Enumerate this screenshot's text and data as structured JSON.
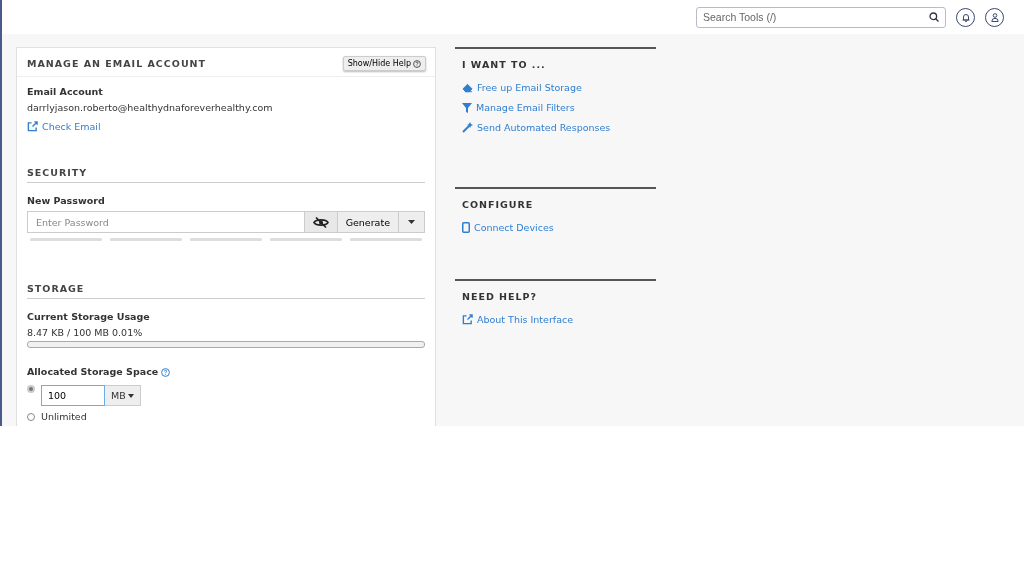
{
  "header": {
    "search": {
      "placeholder": "Search Tools (/)"
    }
  },
  "card": {
    "title": "MANAGE AN EMAIL ACCOUNT",
    "help_button": "Show/Hide Help",
    "email_account": {
      "label": "Email Account",
      "value": "darrlyjason.roberto@healthydnaforeverhealthy.com",
      "link": "Check Email"
    },
    "security": {
      "heading": "SECURITY",
      "label": "New Password",
      "placeholder": "Enter Password",
      "generate": "Generate"
    },
    "storage": {
      "heading": "STORAGE",
      "usage_label": "Current Storage Usage",
      "usage": "8.47 KB / 100 MB 0.01%",
      "level": 0.0001,
      "allocated_label": "Allocated Storage Space",
      "options": [
        {
          "kind": "quota",
          "selected": true,
          "value": "100",
          "unit": "MB"
        },
        {
          "kind": "plain",
          "selected": false,
          "label": "Unlimited"
        }
      ]
    }
  },
  "sidebar": [
    {
      "heading": "I WANT TO ...",
      "links": [
        {
          "kind": "eraser",
          "label": "Free up Email Storage"
        },
        {
          "kind": "filter",
          "label": "Manage Email Filters"
        },
        {
          "kind": "wand",
          "label": "Send Automated Responses"
        }
      ]
    },
    {
      "heading": "CONFIGURE",
      "links": [
        {
          "kind": "phone",
          "label": "Connect Devices"
        }
      ]
    },
    {
      "heading": "NEED HELP?",
      "links": [
        {
          "kind": "external",
          "label": "About This Interface"
        }
      ]
    }
  ]
}
